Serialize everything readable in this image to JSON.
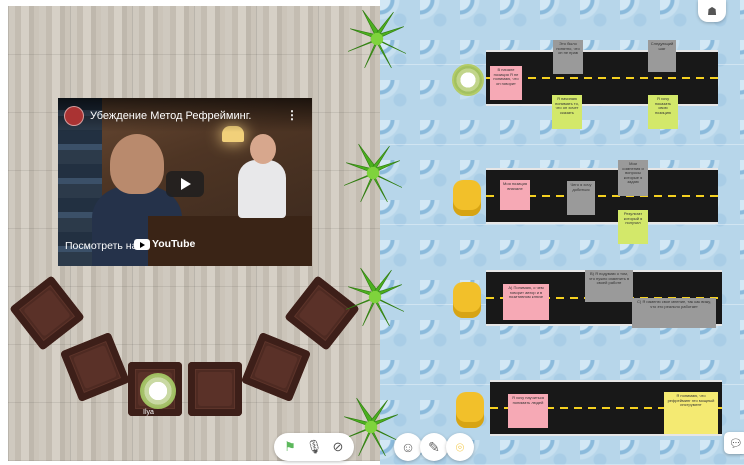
{
  "video": {
    "title": "Убеждение Метод Рефрейминг.",
    "watch_label": "Посмотреть на",
    "platform": "YouTube",
    "menu_icon": "more-vertical-icon",
    "play_icon": "play-icon"
  },
  "avatar": {
    "name": "Ilya"
  },
  "roads": [
    {
      "seat": "user-avatar",
      "notes": [
        {
          "color": "pink",
          "text": "В начале позиция Я не понимаю, что он говорит"
        },
        {
          "color": "grey",
          "text": "Это было понятно, что он не прав"
        },
        {
          "color": "lime",
          "text": "Я начинаю понимать то, что он хочет сказать"
        },
        {
          "color": "grey",
          "text": "Следующий шаг"
        },
        {
          "color": "lime",
          "text": "Я хочу показать свою позицию"
        }
      ]
    },
    {
      "seat": "yellow-chair",
      "notes": [
        {
          "color": "pink",
          "text": "Моя позиция вначале"
        },
        {
          "color": "grey",
          "text": "Чего я хочу добиться"
        },
        {
          "color": "grey",
          "text": "Мои сомнения и вопросы которые я задаю"
        },
        {
          "color": "lime",
          "text": "Результат который я получил"
        }
      ]
    },
    {
      "seat": "yellow-chair",
      "notes": [
        {
          "color": "pink",
          "text": "А) Понимаю, о чем говорит автор и в позитивном ключе"
        },
        {
          "color": "grey",
          "text": "В) Я подумаю о том, что нужно изменить в своей работе"
        },
        {
          "color": "grey",
          "text": "С) Я изменю свое мнение, так как вижу, что это реально работает"
        }
      ]
    },
    {
      "seat": "yellow-chair",
      "notes": [
        {
          "color": "pink",
          "text": "Я хочу научиться понимать людей"
        },
        {
          "color": "yel",
          "text": "Я понимаю, что рефрейминг это мощный инструмент"
        }
      ]
    }
  ],
  "toolbar": {
    "items": [
      "flag-icon",
      "microphone-icon",
      "camera-off-icon"
    ],
    "emoji_icon": "smile-icon",
    "pencil_icon": "pencil-icon",
    "location_icon": "location-pin-icon",
    "chat_icon": "chat-icon",
    "users_icon": "users-icon"
  },
  "colors": {
    "accent_green": "#5cb85c",
    "road": "#181818",
    "lane": "#f4d020",
    "chair_yellow": "#f2c02a"
  }
}
